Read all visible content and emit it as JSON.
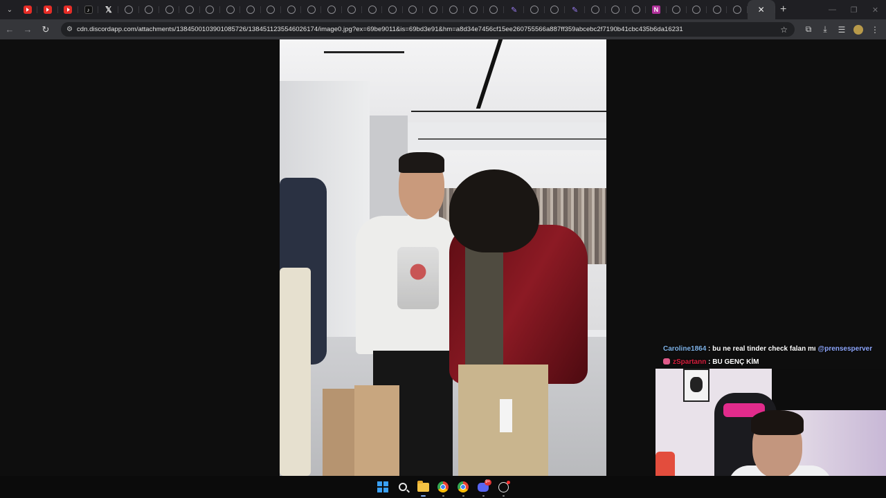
{
  "browser": {
    "tabs": [
      {
        "icon": "youtube-icon"
      },
      {
        "icon": "youtube-icon"
      },
      {
        "icon": "youtube-icon"
      },
      {
        "icon": "tiktok-icon"
      },
      {
        "icon": "x-icon"
      },
      {
        "icon": "globe-icon"
      },
      {
        "icon": "globe-icon"
      },
      {
        "icon": "globe-icon"
      },
      {
        "icon": "globe-icon"
      },
      {
        "icon": "globe-icon"
      },
      {
        "icon": "globe-icon"
      },
      {
        "icon": "globe-icon"
      },
      {
        "icon": "globe-icon"
      },
      {
        "icon": "globe-icon"
      },
      {
        "icon": "globe-icon"
      },
      {
        "icon": "globe-icon"
      },
      {
        "icon": "globe-icon"
      },
      {
        "icon": "globe-icon"
      },
      {
        "icon": "globe-icon"
      },
      {
        "icon": "globe-icon"
      },
      {
        "icon": "globe-icon"
      },
      {
        "icon": "globe-icon"
      },
      {
        "icon": "globe-icon"
      },
      {
        "icon": "globe-icon"
      },
      {
        "icon": "pen-icon"
      },
      {
        "icon": "globe-icon"
      },
      {
        "icon": "globe-icon"
      },
      {
        "icon": "pen-icon"
      },
      {
        "icon": "globe-icon"
      },
      {
        "icon": "globe-icon"
      },
      {
        "icon": "globe-icon"
      },
      {
        "icon": "globe-icon"
      },
      {
        "icon": "n-icon"
      },
      {
        "icon": "globe-icon"
      },
      {
        "icon": "globe-icon"
      },
      {
        "icon": "globe-icon"
      },
      {
        "icon": "globe-icon"
      }
    ],
    "active_tab": {
      "icon": "close-icon"
    },
    "new_tab_label": "+",
    "url": "cdn.discordapp.com/attachments/1384500103901085726/1384511235546026174/image0.jpg?ex=69be9011&is=69bd3e91&hm=a8d34e7456cf15ee260755566a887ff359abcebc2f7190b41cbc435b6da16231"
  },
  "chat": {
    "messages": [
      {
        "user": "Caroline1864",
        "separator": ":",
        "text": "bu ne real tinder check falan mı",
        "mention": "@prensesperver",
        "user_color": "#7fb3e8"
      },
      {
        "user": "zSpartann",
        "separator": ":",
        "text": "BU GENÇ KİM",
        "user_color": "#d81f3e",
        "badge": "heart-badge-icon"
      }
    ]
  },
  "taskbar": {
    "apps": [
      {
        "name": "windows-start-icon"
      },
      {
        "name": "search-icon"
      },
      {
        "name": "file-explorer-icon"
      },
      {
        "name": "chrome-icon"
      },
      {
        "name": "chrome-icon"
      },
      {
        "name": "discord-icon",
        "badge": "9+"
      },
      {
        "name": "obs-icon"
      }
    ]
  },
  "colors": {
    "tabstrip": "#1f1f23",
    "toolbar": "#35363a",
    "omnibox": "#202124",
    "viewer_bg": "#0e0e0e",
    "taskbar": "#0b0b0b"
  }
}
